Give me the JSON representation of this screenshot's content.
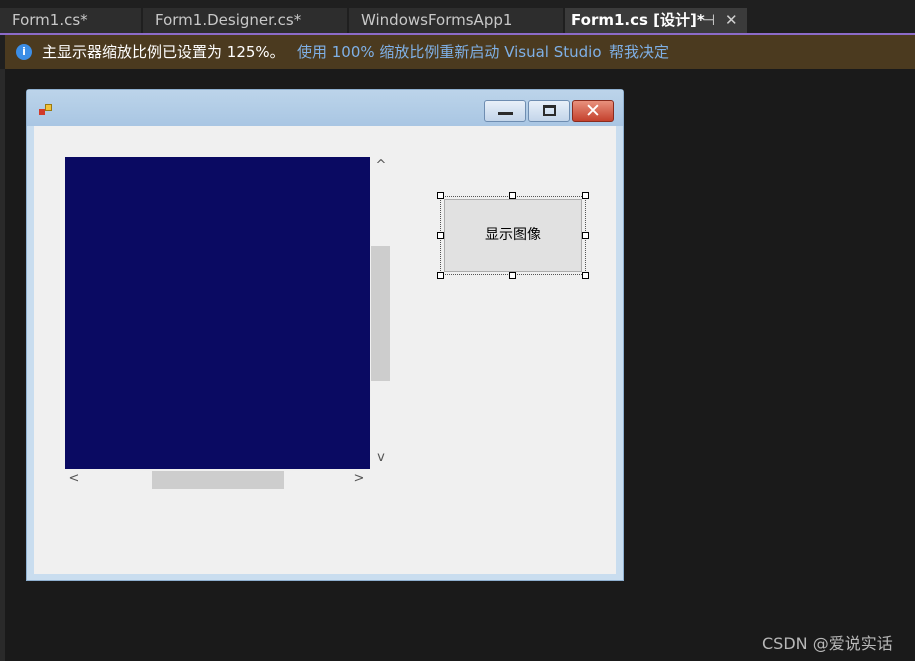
{
  "tabs": [
    {
      "label": "Form1.cs*"
    },
    {
      "label": "Form1.Designer.cs*"
    },
    {
      "label": "WindowsFormsApp1"
    },
    {
      "label": "Form1.cs [设计]*",
      "active": true
    }
  ],
  "tab_controls": {
    "pin_glyph": "⊣",
    "close_glyph": "✕"
  },
  "infobar": {
    "icon_glyph": "i",
    "message": "主显示器缩放比例已设置为 125%。",
    "restart_link": "使用 100% 缩放比例重新启动 Visual Studio",
    "help_link": "帮我决定"
  },
  "form": {
    "close_glyph": "✕",
    "button_label": "显示图像"
  },
  "scroll_arrows": {
    "up": "^",
    "down": "v",
    "left": "<",
    "right": ">"
  },
  "watermark": "CSDN @爱说实话",
  "colors": {
    "picture_fill": "#0a0a62",
    "tab_accent": "#8c6bc8",
    "infobar_bg": "#4b3a1f"
  },
  "icons": [
    "info-icon",
    "pin-icon",
    "close-icon",
    "app-icon",
    "minimize-icon",
    "maximize-icon"
  ]
}
